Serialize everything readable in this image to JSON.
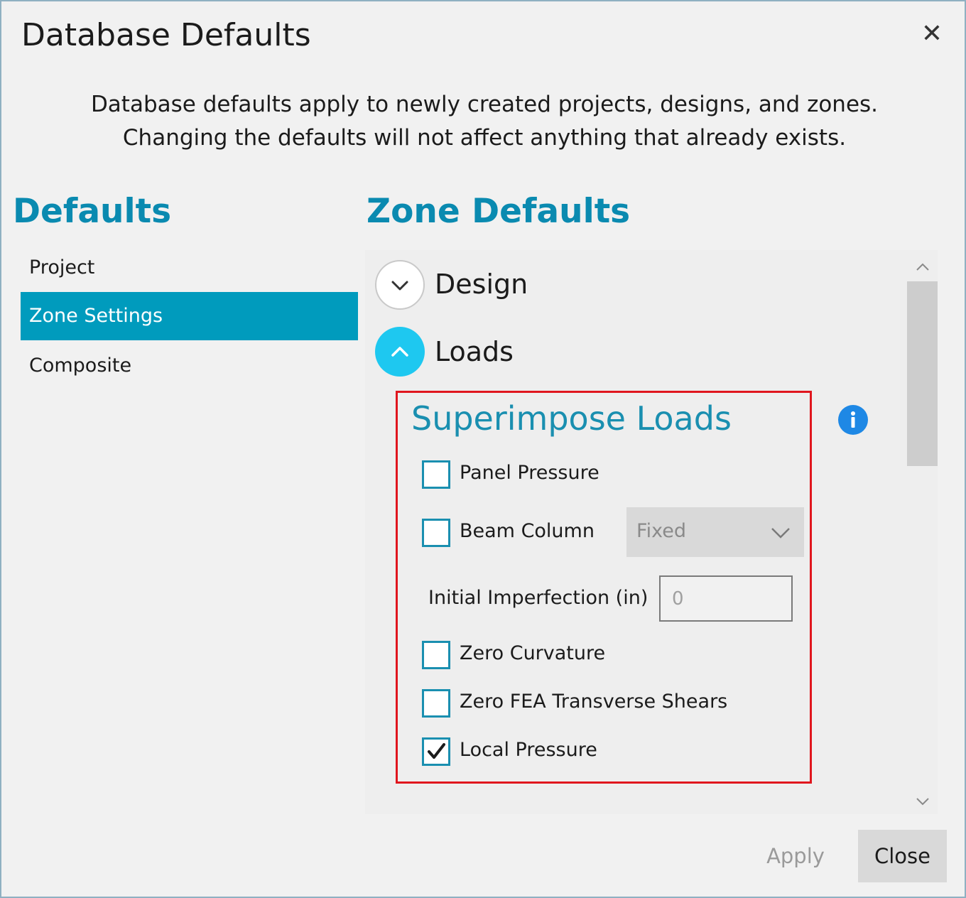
{
  "window": {
    "title": "Database Defaults",
    "close_icon": "close-icon"
  },
  "description": {
    "line1": "Database defaults apply to newly created projects, designs, and zones.",
    "line2": "Changing the defaults will not affect anything that already exists."
  },
  "sidebar": {
    "heading": "Defaults",
    "items": [
      {
        "label": "Project",
        "active": false
      },
      {
        "label": "Zone Settings",
        "active": true
      },
      {
        "label": "Composite",
        "active": false
      }
    ]
  },
  "main": {
    "heading": "Zone Defaults",
    "sections": [
      {
        "label": "Design",
        "expanded": false
      },
      {
        "label": "Loads",
        "expanded": true
      }
    ],
    "superimpose": {
      "heading": "Superimpose Loads",
      "options": [
        {
          "label": "Panel Pressure",
          "checked": false
        },
        {
          "label": "Beam Column",
          "checked": false
        },
        {
          "label": "Zero Curvature",
          "checked": false
        },
        {
          "label": "Zero FEA Transverse Shears",
          "checked": false
        },
        {
          "label": "Local Pressure",
          "checked": true
        }
      ],
      "beam_column_select": {
        "value": "Fixed"
      },
      "initial_imperfection": {
        "label": "Initial Imperfection (in)",
        "value": "0"
      }
    }
  },
  "footer": {
    "apply_label": "Apply",
    "close_label": "Close"
  },
  "colors": {
    "accent": "#0a8ab0",
    "selected_nav": "#009bbd",
    "expand_active": "#1ec8f0",
    "highlight_border": "#e0161e",
    "info": "#1e88e5"
  }
}
